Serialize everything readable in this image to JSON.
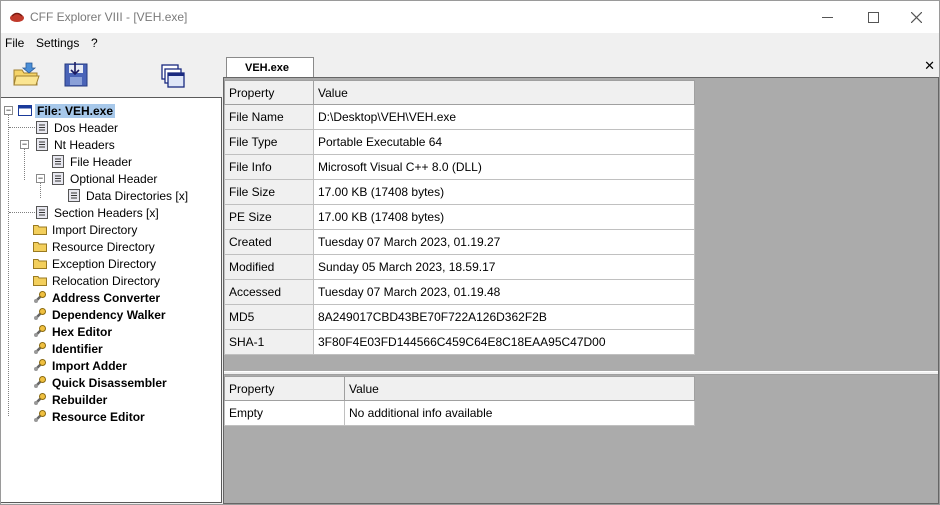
{
  "window": {
    "title": "CFF Explorer VIII - [VEH.exe]",
    "controls": [
      "minimize",
      "maximize",
      "close"
    ]
  },
  "menu": {
    "items": [
      "File",
      "Settings",
      "?"
    ]
  },
  "toolbar": {
    "buttons": [
      "open-folder-icon",
      "save-disk-icon",
      "windows-icon"
    ]
  },
  "tree": {
    "items": [
      {
        "label": "File: VEH.exe",
        "icon": "window-icon",
        "selected": true
      },
      {
        "label": "Dos Header",
        "icon": "table-icon"
      },
      {
        "label": "Nt Headers",
        "icon": "table-icon"
      },
      {
        "label": "File Header",
        "icon": "table-icon"
      },
      {
        "label": "Optional Header",
        "icon": "table-icon"
      },
      {
        "label": "Data Directories [x]",
        "icon": "table-icon"
      },
      {
        "label": "Section Headers [x]",
        "icon": "table-icon"
      },
      {
        "label": "Import Directory",
        "icon": "folder-icon"
      },
      {
        "label": "Resource Directory",
        "icon": "folder-icon"
      },
      {
        "label": "Exception Directory",
        "icon": "folder-icon"
      },
      {
        "label": "Relocation Directory",
        "icon": "folder-icon"
      },
      {
        "label": "Address Converter",
        "icon": "wrench-icon"
      },
      {
        "label": "Dependency Walker",
        "icon": "wrench-icon"
      },
      {
        "label": "Hex Editor",
        "icon": "wrench-icon"
      },
      {
        "label": "Identifier",
        "icon": "wrench-icon"
      },
      {
        "label": "Import Adder",
        "icon": "wrench-icon"
      },
      {
        "label": "Quick Disassembler",
        "icon": "wrench-icon"
      },
      {
        "label": "Rebuilder",
        "icon": "wrench-icon"
      },
      {
        "label": "Resource Editor",
        "icon": "wrench-icon"
      }
    ]
  },
  "tab": {
    "label": "VEH.exe",
    "close": "✕"
  },
  "main_table": {
    "headers": [
      "Property",
      "Value"
    ],
    "rows": [
      [
        "File Name",
        "D:\\Desktop\\VEH\\VEH.exe"
      ],
      [
        "File Type",
        "Portable Executable 64"
      ],
      [
        "File Info",
        "Microsoft Visual C++ 8.0 (DLL)"
      ],
      [
        "File Size",
        "17.00 KB (17408 bytes)"
      ],
      [
        "PE Size",
        "17.00 KB (17408 bytes)"
      ],
      [
        "Created",
        "Tuesday 07 March 2023, 01.19.27"
      ],
      [
        "Modified",
        "Sunday 05 March 2023, 18.59.17"
      ],
      [
        "Accessed",
        "Tuesday 07 March 2023, 01.19.48"
      ],
      [
        "MD5",
        "8A249017CBD43BE70F722A126D362F2B"
      ],
      [
        "SHA-1",
        "3F80F4E03FD144566C459C64E8C18EAA95C47D00"
      ]
    ]
  },
  "info_table": {
    "headers": [
      "Property",
      "Value"
    ],
    "rows": [
      [
        "Empty",
        "No additional info available"
      ]
    ]
  }
}
